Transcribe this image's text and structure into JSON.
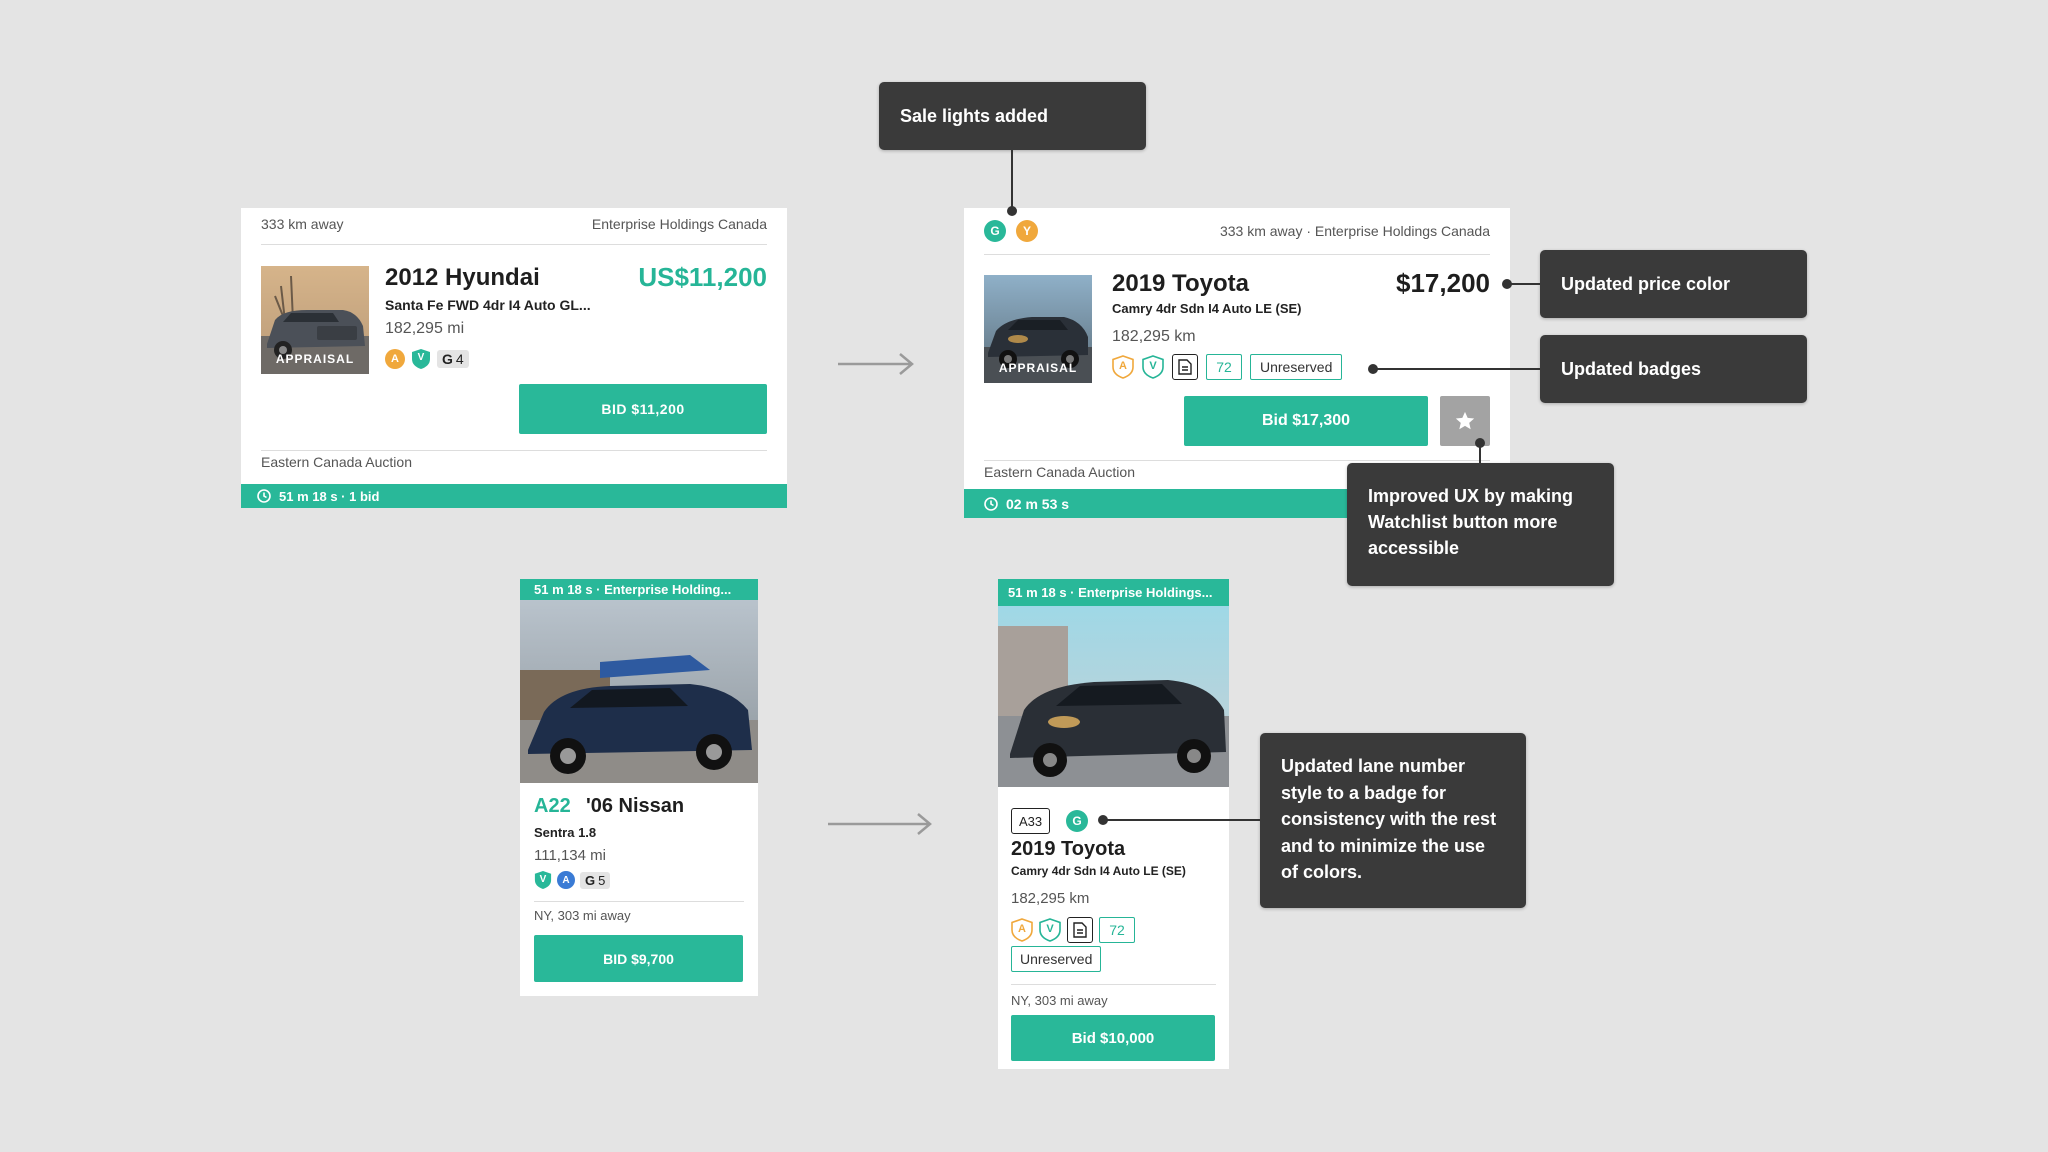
{
  "colors": {
    "teal": "#29b899",
    "dark_note": "#3a3a3a",
    "background": "#e4e4e4",
    "orange": "#f0a83c",
    "blue": "#3a7bd5"
  },
  "card_old_list": {
    "distance": "333 km away",
    "seller": "Enterprise Holdings Canada",
    "title": "2012 Hyundai",
    "subtitle": "Santa Fe FWD 4dr I4 Auto GL...",
    "mileage": "182,295 mi",
    "price": "US$11,200",
    "thumb_label": "APPRAISAL",
    "badges": {
      "a": "A",
      "v": "V",
      "count": "4"
    },
    "bid_label": "BID $11,200",
    "auction": "Eastern Canada Auction",
    "timer": "51 m 18 s · 1 bid"
  },
  "card_new_list": {
    "lights": [
      "G",
      "Y"
    ],
    "meta": "333 km away · Enterprise Holdings Canada",
    "title": "2019 Toyota",
    "subtitle": "Camry 4dr Sdn I4 Auto LE (SE)",
    "mileage": "182,295 km",
    "price": "$17,200",
    "thumb_label": "APPRAISAL",
    "badges": {
      "a": "A",
      "v": "V",
      "score": "72",
      "status": "Unreserved"
    },
    "bid_label": "Bid $17,300",
    "watchlist_icon": "star-icon",
    "auction": "Eastern Canada Auction",
    "timer": "02 m 53 s"
  },
  "card_old_grid": {
    "header": "51 m 18 s · Enterprise Holding...",
    "lane": "A22",
    "title": "'06 Nissan",
    "subtitle": "Sentra 1.8",
    "mileage": "111,134 mi",
    "badges": {
      "v": "V",
      "a": "A",
      "count": "5"
    },
    "location": "NY, 303 mi away",
    "bid_label": "BID $9,700"
  },
  "card_new_grid": {
    "header": "51 m 18 s · Enterprise Holdings...",
    "lane": "A33",
    "light": "G",
    "title": "2019 Toyota",
    "subtitle": "Camry 4dr Sdn I4 Auto LE (SE)",
    "mileage": "182,295 km",
    "badges": {
      "a": "A",
      "v": "V",
      "score": "72",
      "status": "Unreserved"
    },
    "location": "NY, 303 mi away",
    "bid_label": "Bid $10,000"
  },
  "notes": {
    "sale_lights": "Sale lights added",
    "price_color": "Updated price color",
    "badges": "Updated badges",
    "watchlist": "Improved UX by making Watchlist button more accessible",
    "lane": "Updated lane number style to a badge for consistency with the rest and to minimize the use of colors."
  }
}
